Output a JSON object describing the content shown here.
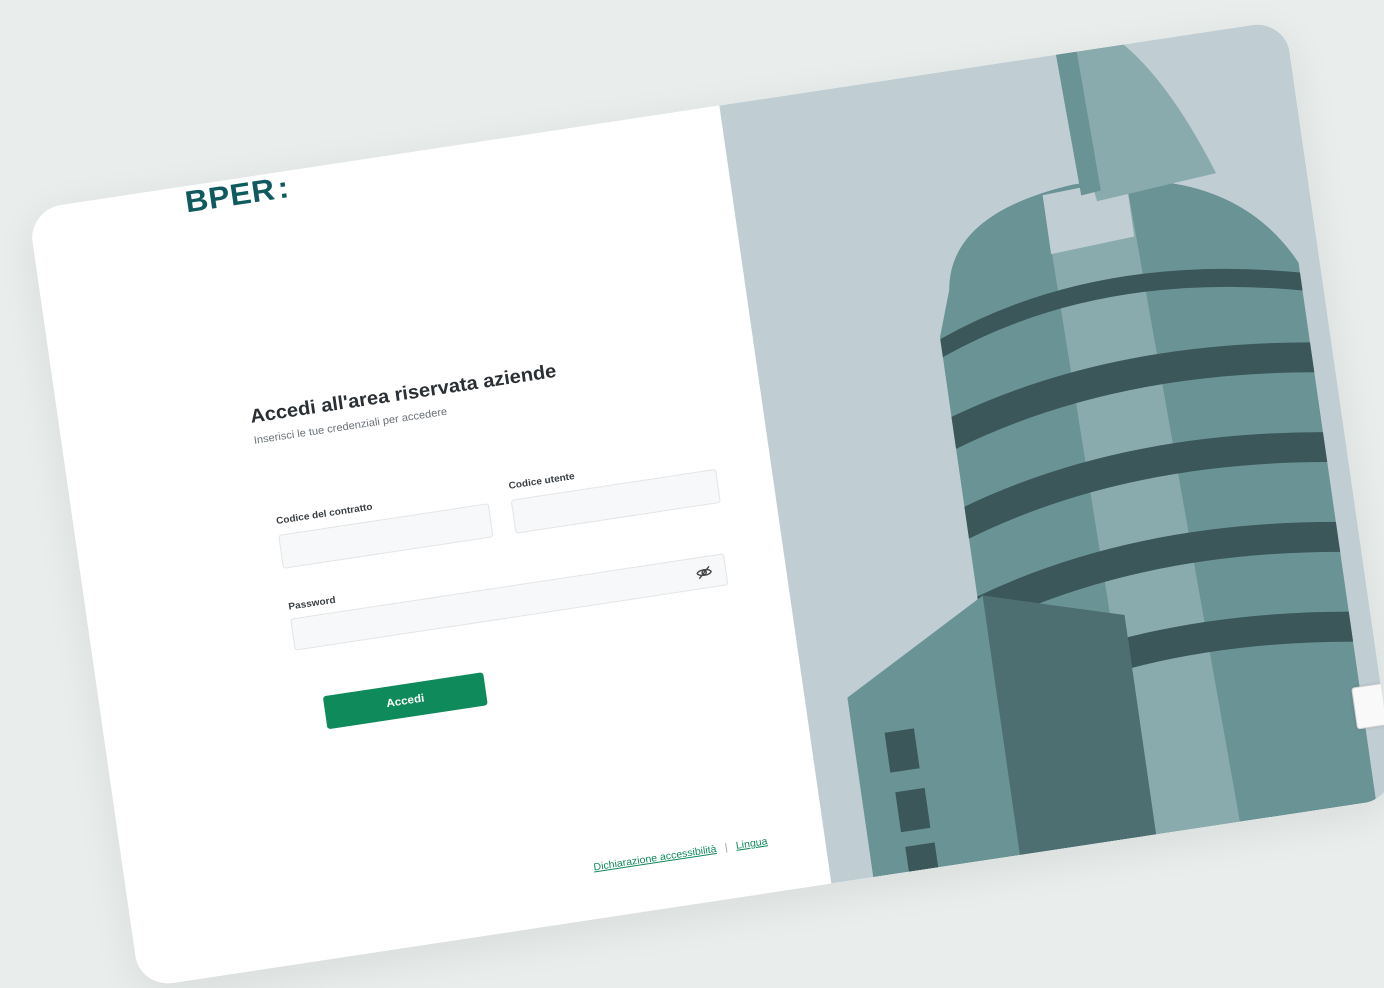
{
  "brand": {
    "logo_text": "BPER",
    "logo_mark": ":"
  },
  "login": {
    "title": "Accedi all'area riservata aziende",
    "subtitle": "Inserisci le tue credenziali per accedere",
    "contract_label": "Codice del contratto",
    "contract_value": "",
    "user_label": "Codice utente",
    "user_value": "",
    "password_label": "Password",
    "password_value": "",
    "submit_label": "Accedi"
  },
  "footer": {
    "accessibility_link": "Dichiarazione accessibilità",
    "separator": "|",
    "language_link": "Lingua"
  },
  "colors": {
    "brand": "#0f5a5e",
    "accent": "#0f8a5a",
    "illustration_bg": "#c0ced3"
  },
  "icons": {
    "password_toggle": "eye-off-icon",
    "captcha": "recaptcha-icon"
  }
}
